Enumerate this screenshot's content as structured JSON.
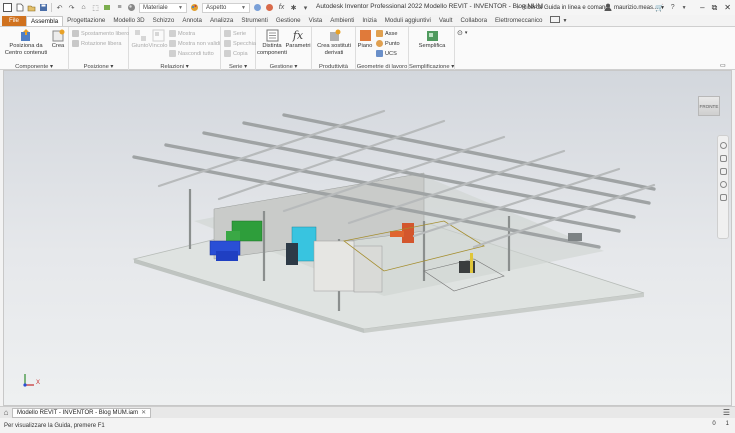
{
  "app": {
    "title": "Autodesk Inventor Professional 2022    Modello REVIT - INVENTOR - Blog MUM"
  },
  "titlebar": {
    "material_label": "Materiale",
    "appearance_label": "Aspetto",
    "search_label": "Ricerca Guida in linea e comandi",
    "user_label": "maurizio.meas...",
    "window_controls": [
      "–",
      "⧉",
      "✕"
    ]
  },
  "tabs": [
    {
      "label": "File",
      "id": "file"
    },
    {
      "label": "Assembla",
      "id": "assembla"
    },
    {
      "label": "Progettazione",
      "id": "progettazione"
    },
    {
      "label": "Modello 3D",
      "id": "modello3d"
    },
    {
      "label": "Schizzo",
      "id": "schizzo"
    },
    {
      "label": "Annota",
      "id": "annota"
    },
    {
      "label": "Analizza",
      "id": "analizza"
    },
    {
      "label": "Strumenti",
      "id": "strumenti"
    },
    {
      "label": "Gestione",
      "id": "gestione"
    },
    {
      "label": "Vista",
      "id": "vista"
    },
    {
      "label": "Ambienti",
      "id": "ambienti"
    },
    {
      "label": "Inizia",
      "id": "inizia"
    },
    {
      "label": "Moduli aggiuntivi",
      "id": "moduli"
    },
    {
      "label": "Vault",
      "id": "vault"
    },
    {
      "label": "Collabora",
      "id": "collabora"
    },
    {
      "label": "Elettromeccanico",
      "id": "elettromeccanico"
    }
  ],
  "active_tab": "Assembla",
  "ribbon": {
    "componente": {
      "label": "Componente ▾",
      "posiziona": "Posiziona da Centro contenuti",
      "crea": "Crea"
    },
    "posizione": {
      "label": "Posizione ▾",
      "spostamento": "Spostamento libero",
      "rotazione": "Rotazione libera"
    },
    "relazioni": {
      "label": "Relazioni ▾",
      "giunto": "Giunto",
      "vincolo": "Vincolo",
      "mostra": "Mostra",
      "mostra_non_validi": "Mostra non validi",
      "nascondi_tutto": "Nascondi tutto"
    },
    "serie": {
      "label": "Serie ▾",
      "serie": "Serie",
      "specchia": "Specchia",
      "copia": "Copia"
    },
    "gestione": {
      "label": "Gestione ▾",
      "distinta": "Distinta componenti",
      "parametri": "Parametri"
    },
    "produttivita": {
      "label": "Produttività",
      "crea_sostituti": "Crea sostituti derivati"
    },
    "geometrie": {
      "label": "Geometrie di lavoro",
      "piano": "Piano",
      "asse": "Asse",
      "punto": "Punto",
      "ucs": "UCS"
    },
    "semplificazione": {
      "label": "Semplificazione ▾",
      "semplifica": "Semplifica"
    }
  },
  "viewport": {
    "viewcube_label": "FRONTE",
    "axis_x": "X"
  },
  "document_tab": {
    "label": "Modello REVIT - INVENTOR - Blog MUM.iam"
  },
  "status": {
    "text": "Per visualizzare la Guida, premere F1",
    "count_a": "0",
    "count_b": "1"
  },
  "colors": {
    "file_tab": "#d0721f",
    "accent_blue": "#2e6fbf"
  }
}
